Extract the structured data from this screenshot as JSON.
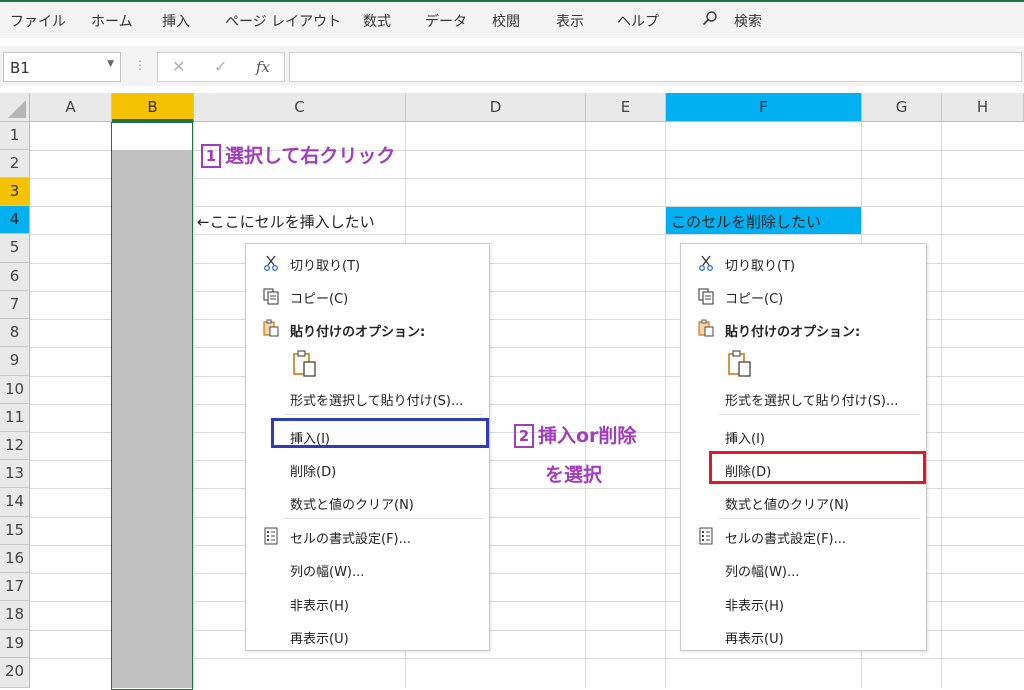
{
  "ribbon": {
    "tabs": [
      "ファイル",
      "ホーム",
      "挿入",
      "ページ レイアウト",
      "数式",
      "データ",
      "校閲",
      "表示",
      "ヘルプ"
    ],
    "search_label": "検索"
  },
  "formula_bar": {
    "name_box": "B1",
    "fx_label": "fx",
    "formula_value": ""
  },
  "columns": [
    "A",
    "B",
    "C",
    "D",
    "E",
    "F",
    "G",
    "H"
  ],
  "rows": [
    "1",
    "2",
    "3",
    "4",
    "5",
    "6",
    "7",
    "8",
    "9",
    "10",
    "11",
    "12",
    "13",
    "14",
    "15",
    "16",
    "17",
    "18",
    "19",
    "20"
  ],
  "cells": {
    "C4": "←ここにセルを挿入したい",
    "F4": "このセルを削除したい"
  },
  "annotations": {
    "step1_num": "1",
    "step1_text": "選択して右クリック",
    "step2_num": "2",
    "step2_text": "挿入or削除",
    "step2_text_line2": "を選択"
  },
  "context_menu": {
    "cut": "切り取り(T)",
    "copy": "コピー(C)",
    "paste_options": "貼り付けのオプション:",
    "paste_special": "形式を選択して貼り付け(S)...",
    "insert": "挿入(I)",
    "delete": "削除(D)",
    "clear_contents": "数式と値のクリア(N)",
    "format_cells": "セルの書式設定(F)...",
    "column_width": "列の幅(W)...",
    "hide": "非表示(H)",
    "unhide": "再表示(U)"
  },
  "colors": {
    "selected_col_header": "#f5c200",
    "highlight_blue": "#00b0f0",
    "selection_gray": "#c0c0c0",
    "selection_border": "#217346",
    "annotation_purple": "#a03dbb",
    "insert_box": "#2e3cb8",
    "delete_box": "#e0182a"
  }
}
